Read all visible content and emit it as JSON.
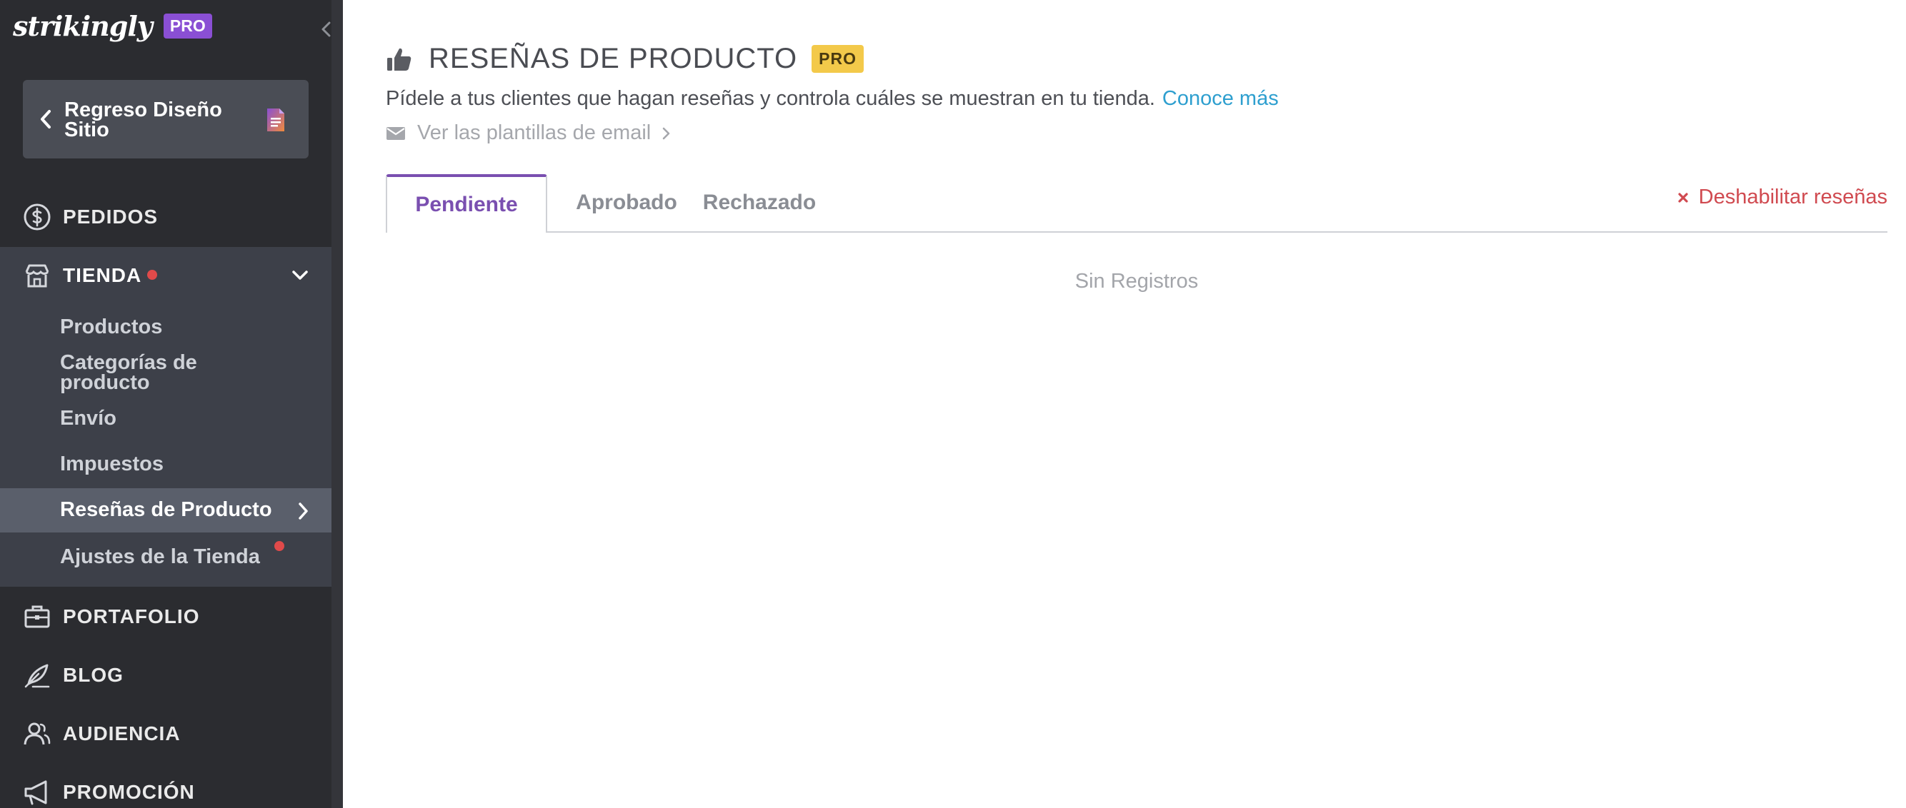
{
  "sidebar": {
    "logo_text": "strikingly",
    "pro_badge": "PRO",
    "back_label": "Regreso Diseño Sitio",
    "nav": {
      "pedidos": "PEDIDOS",
      "tienda": "TIENDA",
      "portafolio": "PORTAFOLIO",
      "blog": "BLOG",
      "audiencia": "AUDIENCIA",
      "promocion": "PROMOCIÓN"
    },
    "tienda_submenu": {
      "productos": "Productos",
      "categorias": "Categorías de producto",
      "envio": "Envío",
      "impuestos": "Impuestos",
      "resenas": "Reseñas de Producto",
      "ajustes": "Ajustes de la Tienda"
    }
  },
  "main": {
    "title": "RESEÑAS DE PRODUCTO",
    "pro_badge": "PRO",
    "subtitle": "Pídele a tus clientes que hagan reseñas y controla cuáles se muestran en tu tienda.",
    "learn_more": "Conoce más",
    "email_templates": "Ver las plantillas de email",
    "tabs": [
      "Pendiente",
      "Aprobado",
      "Rechazado"
    ],
    "disable_label": "Deshabilitar reseñas",
    "empty_state": "Sin Registros"
  },
  "colors": {
    "sidebar_bg": "#2b2c30",
    "submenu_bg": "#3d4049",
    "active_tab": "#7a4fb0",
    "link": "#2e9fcf",
    "danger": "#d04a50",
    "pro_purple": "#8a4fd4",
    "pro_yellow": "#f3c94a"
  }
}
